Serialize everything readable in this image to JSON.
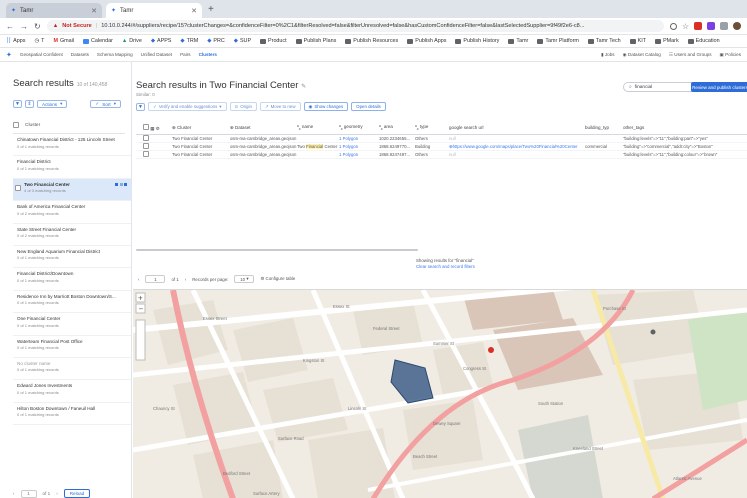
{
  "browser": {
    "tabs": [
      {
        "label": "Tamr"
      },
      {
        "label": "Tamr"
      }
    ],
    "not_secure": "Not Secure",
    "url": "10.10.0.244/#/suppliers/recipe/15?clusterChanges=&confidenceFilter=0%2C1&filterResolved=false&filterUnresolved=false&hasCustomConfidenceFilter=false&lastSelectedSupplier=9f49f2e6-c8..."
  },
  "bookmarks": [
    "Apps",
    "T",
    "Gmail",
    "Calendar",
    "Drive",
    "APPS",
    "TRM",
    "PRC",
    "SUP",
    "Product",
    "Publish Plans",
    "Publish Resources",
    "Publish Apps",
    "Publish History",
    "Tamr",
    "Tamr Platform",
    "Tamr Tech",
    "KIT",
    "PMark",
    "Education"
  ],
  "appnav": {
    "items": [
      "Geospatial Confident",
      "Datasets",
      "Schema Mapping",
      "Unified Dataset",
      "Pairs",
      "Clusters"
    ],
    "right": [
      "Jobs",
      "Dataset Catalog",
      "Users and Groups",
      "Policies"
    ]
  },
  "left": {
    "title": "Search results",
    "count": "10 of 140,458",
    "actions_label": "Actions",
    "sort_label": "Sort",
    "header_label": "Cluster",
    "items": [
      {
        "name": "Chinatown Financial District - 125 Lincoln Street",
        "meta": "0 of 1 matching records"
      },
      {
        "name": "Financial District",
        "meta": "0 of 1 matching records"
      },
      {
        "name": "Two Financial Center",
        "meta": "4 of 3 matching records"
      },
      {
        "name": "Bank of America Financial Center",
        "meta": "0 of 2 matching records"
      },
      {
        "name": "State Street Financial Center",
        "meta": "0 of 2 matching records"
      },
      {
        "name": "New England Aquarium Financial District",
        "meta": "0 of 1 matching records"
      },
      {
        "name": "Financial District/Downtown",
        "meta": "0 of 1 matching records"
      },
      {
        "name": "Residence Inn by Marriott Boston Downtown/S...",
        "meta": "0 of 1 matching records"
      },
      {
        "name": "One Financial Center",
        "meta": "0 of 1 matching records"
      },
      {
        "name": "Waterteam Financial Post Office",
        "meta": "0 of 1 matching records"
      },
      {
        "name": "No cluster name",
        "meta": "0 of 1 matching records"
      },
      {
        "name": "Edward Jones Investments",
        "meta": "0 of 1 matching records"
      },
      {
        "name": "Hilton Boston Downtown / Faneuil Hall",
        "meta": "0 of 1 matching records"
      }
    ],
    "pager": {
      "page": "1",
      "of": "of 1",
      "reload": "Reload"
    }
  },
  "main": {
    "title": "Search results in Two Financial Center",
    "similar": "Similar: 0",
    "search_value": "financial",
    "publish_label": "Review and publish clusters",
    "toolbar": [
      "Verify and enable suggestions",
      "Origin",
      "Move to new",
      "Show changes",
      "Open details"
    ],
    "columns": [
      "Cluster",
      "Dataset",
      "name",
      "geometry",
      "area",
      "type",
      "google search url",
      "building_typ",
      "other_tags"
    ],
    "rows": [
      {
        "cluster": "Two Financial Center",
        "dataset": "osm-ma-cambridge_areas.geojson",
        "name": "",
        "geometry": "1 Polygon",
        "area": "1020.2234655...",
        "type": "Others",
        "url": "null",
        "building_typ": "",
        "other_tags": "\"building:levels\"=>\"11\",\"building:part\"=>\"yes\""
      },
      {
        "cluster": "Two Financial Center",
        "dataset": "osm-ma-cambridge_areas.geojson",
        "name_pre": "Two ",
        "name_hl": "Financial",
        "name_post": " Center",
        "geometry": "1 Polygon",
        "area": "1868.6249770...",
        "type": "Building",
        "url": "https://www.google.com/maps/place/Two%20Financial%20Center",
        "building_typ": "commercial",
        "other_tags": "\"building\"=>\"commercial\",\"addr:city\"=>\"Boston\""
      },
      {
        "cluster": "Two Financial Center",
        "dataset": "osm-ma-cambridge_areas.geojson",
        "name": "",
        "geometry": "1 Polygon",
        "area": "1868.9247497...",
        "type": "Others",
        "url": "null",
        "building_typ": "",
        "other_tags": "\"building:levels\"=>\"11\",\"building:colour\"=>\"brown\""
      }
    ],
    "showing": "Showing results for \"financial\"",
    "clear": "Clear search and record filters",
    "tpager": {
      "page": "1",
      "of": "of 1",
      "per_page_label": "Records per page:",
      "per_page": "10",
      "configure": "Configure table"
    },
    "map_labels": [
      "Essex Street",
      "Essex St",
      "Chauncy St",
      "Lincoln St",
      "Kingston St",
      "Beach Street",
      "Bedford Street",
      "Summer St",
      "Surface Road",
      "Kneeland Street",
      "South Station",
      "Atlantic Avenue",
      "Dewey Square",
      "Federal Street",
      "Congress St",
      "Purchase St",
      "Surface Artery"
    ]
  },
  "colors": {
    "accent": "#2e6dd8",
    "selected_row": "#dbe8f9",
    "polygon": "#3e5f8a"
  }
}
